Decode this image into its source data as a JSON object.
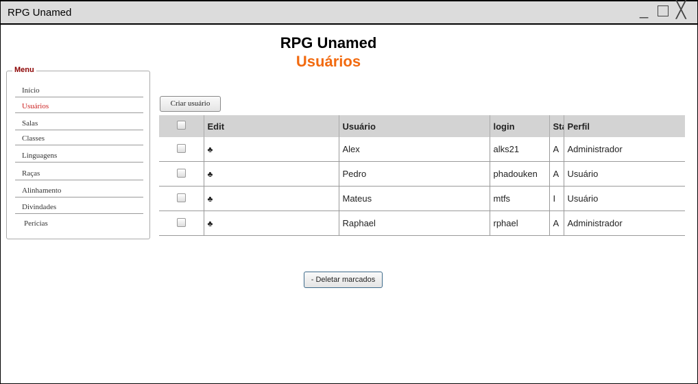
{
  "window": {
    "title": "RPG Unamed",
    "minimize_glyph": "_",
    "close_glyph": "╳"
  },
  "header": {
    "title": "RPG Unamed",
    "subtitle": "Usuários"
  },
  "menu": {
    "legend": "Menu",
    "items": [
      {
        "label": "Início",
        "active": false
      },
      {
        "label": "Usuários",
        "active": true
      },
      {
        "label": "Salas",
        "active": false
      },
      {
        "label": "Classes",
        "active": false
      },
      {
        "label": "Linguagens",
        "active": false
      },
      {
        "label": "Raças",
        "active": false
      },
      {
        "label": "Alinhamento",
        "active": false
      },
      {
        "label": "Divindades",
        "active": false
      },
      {
        "label": "Perícias",
        "active": false
      }
    ]
  },
  "toolbar": {
    "create_label": "Criar usuário",
    "delete_label": "- Deletar marcados"
  },
  "table": {
    "columns": [
      "Edit",
      "Usuário",
      "login",
      "Status",
      "Perfil"
    ],
    "edit_glyph": "♣",
    "rows": [
      {
        "usuario": "Alex",
        "login": "alks21",
        "status": "A",
        "perfil": "Administrador"
      },
      {
        "usuario": "Pedro",
        "login": "phadouken",
        "status": "A",
        "perfil": "Usuário"
      },
      {
        "usuario": "Mateus",
        "login": "mtfs",
        "status": "I",
        "perfil": "Usuário"
      },
      {
        "usuario": "Raphael",
        "login": "rphael",
        "status": "A",
        "perfil": "Administrador"
      }
    ]
  },
  "colors": {
    "subtitle": "#f26a0f",
    "menu_legend": "#8b0000",
    "active_menu": "#cc2222",
    "header_bg": "#d3d3d3"
  }
}
